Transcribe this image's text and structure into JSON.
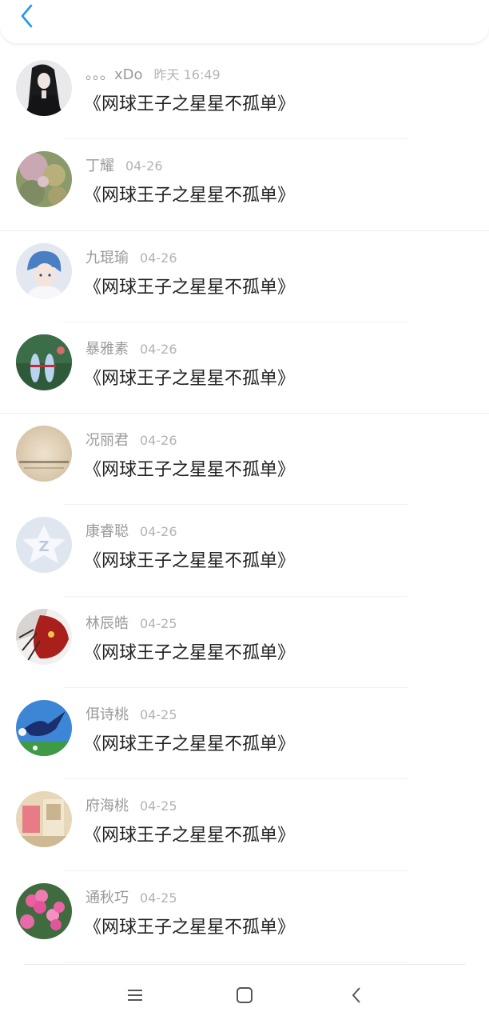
{
  "header": {
    "back_icon": "chevron-left-icon",
    "accent": "#2196f3"
  },
  "rows": [
    {
      "name": "。。。xDo",
      "time": "昨天 16:49",
      "message": "《网球王子之星星不孤单》"
    },
    {
      "name": "丁耀",
      "time": "04-26",
      "message": "《网球王子之星星不孤单》"
    },
    {
      "name": "九琨瑜",
      "time": "04-26",
      "message": "《网球王子之星星不孤单》"
    },
    {
      "name": "暴雅素",
      "time": "04-26",
      "message": "《网球王子之星星不孤单》"
    },
    {
      "name": "况丽君",
      "time": "04-26",
      "message": "《网球王子之星星不孤单》"
    },
    {
      "name": "康睿聪",
      "time": "04-26",
      "message": "《网球王子之星星不孤单》"
    },
    {
      "name": "林辰皓",
      "time": "04-25",
      "message": "《网球王子之星星不孤单》"
    },
    {
      "name": "佴诗桃",
      "time": "04-25",
      "message": "《网球王子之星星不孤单》"
    },
    {
      "name": "府海桃",
      "time": "04-25",
      "message": "《网球王子之星星不孤单》"
    },
    {
      "name": "通秋巧",
      "time": "04-25",
      "message": "《网球王子之星星不孤单》"
    }
  ],
  "navbar": {
    "icons": [
      "menu-icon",
      "home-icon",
      "back-icon"
    ]
  }
}
